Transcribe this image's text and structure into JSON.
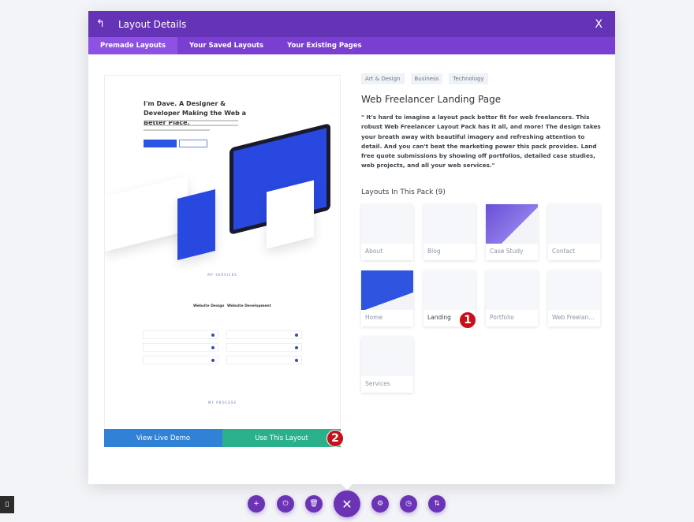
{
  "header": {
    "title": "Layout Details",
    "back_icon": "undo-arrow-icon",
    "close_label": "X"
  },
  "tabs": [
    {
      "label": "Premade Layouts",
      "active": true
    },
    {
      "label": "Your Saved Layouts"
    },
    {
      "label": "Your Existing Pages"
    }
  ],
  "preview": {
    "headline": "I'm Dave. A Designer & Developer Making the Web a Better Place.",
    "live_demo": "View Live Demo",
    "use_layout": "Use This Layout",
    "services_heading": "MY SERVICES",
    "process_heading": "MY PROCESS",
    "service1": "Website Design",
    "service2": "Website Development"
  },
  "details": {
    "categories": [
      "Art & Design",
      "Business",
      "Technology"
    ],
    "title": "Web Freelancer Landing Page",
    "description": "\" It's hard to imagine a layout pack better fit for web freelancers. This robust Web Freelancer Layout Pack has it all, and more! The design takes your breath away with beautiful imagery and refreshing attention to detail. And you can't beat the marketing power this pack provides. Land free quote submissions by showing off portfolios, detailed case studies, web projects, and all your web services.\"",
    "pack_heading": "Layouts In This Pack (9)",
    "layouts": [
      "About",
      "Blog",
      "Case Study",
      "Contact",
      "Home",
      "Landing",
      "Portfolio",
      "Web Freelancer",
      "Services"
    ],
    "selected": "Landing"
  },
  "annotations": [
    "1",
    "2"
  ],
  "toolbar": {
    "icons": [
      "plus-icon",
      "power-icon",
      "trash-icon",
      "close-icon",
      "gear-icon",
      "history-icon",
      "sort-icon"
    ],
    "close_label": "✕"
  },
  "colors": {
    "header": "#6533b5",
    "tabs": "#7a3fd0",
    "live_demo": "#3181d6",
    "use_layout": "#2ab08a",
    "badge": "#c8101a"
  }
}
